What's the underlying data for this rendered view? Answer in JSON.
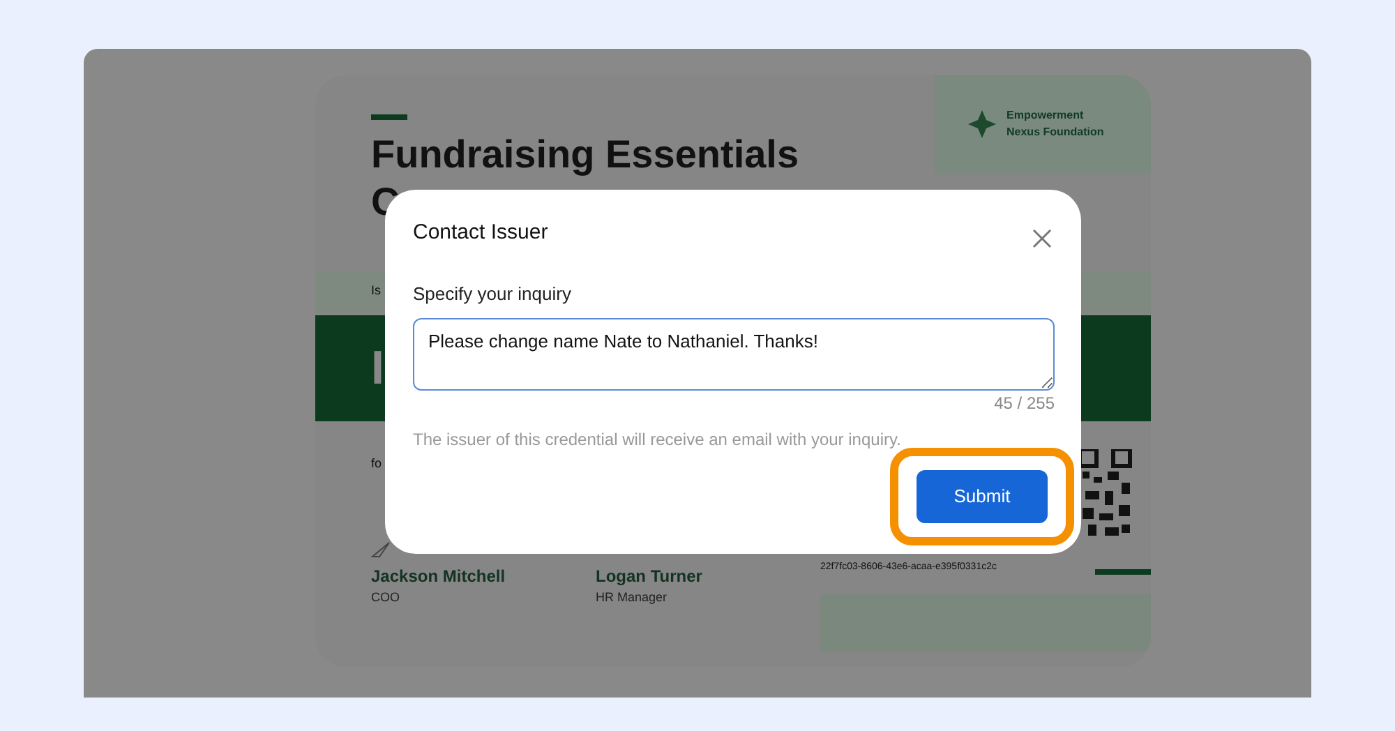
{
  "certificate": {
    "title_lines": [
      "Fundraising Essentials",
      "C"
    ],
    "issuer_name": "Empowerment Nexus Foundation",
    "strip_text": "Is",
    "band_text": "I",
    "recipient_prefix": "fo",
    "signatories": [
      {
        "name": "Jackson Mitchell",
        "role": "COO"
      },
      {
        "name": "Logan Turner",
        "role": "HR Manager"
      }
    ],
    "credential_id": "22f7fc03-8606-43e6-acaa-e395f0331c2c"
  },
  "dialog": {
    "title": "Contact Issuer",
    "field_label": "Specify your inquiry",
    "inquiry": {
      "value": "Please change name Nate to Nathaniel. Thanks!",
      "focused": true
    },
    "counter": "45 / 255",
    "helper_text": "The issuer of this credential will receive an email with your inquiry.",
    "submit_button": {
      "label": "Submit",
      "highlighted": true
    }
  }
}
